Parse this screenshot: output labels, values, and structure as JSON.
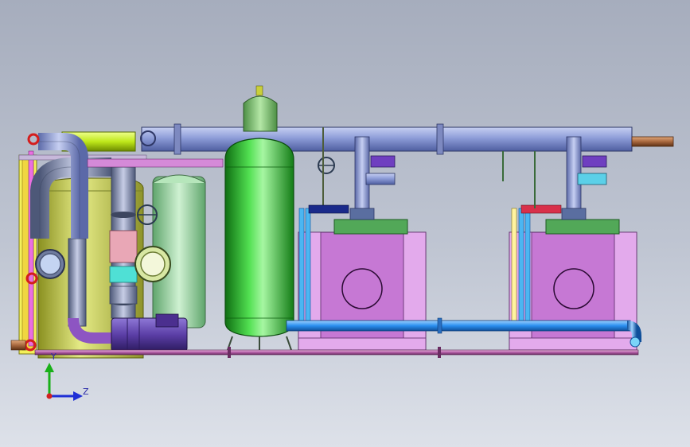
{
  "view": {
    "background_top": "#a6adbd",
    "background_bottom": "#dde1e9"
  },
  "triad": {
    "y_label": "Y",
    "z_label": "Z",
    "y_color": "#19b019",
    "z_color": "#1f2fd6",
    "origin_color": "#d42020"
  },
  "colors": {
    "main_header": "#8e9dd8",
    "main_tank": "#2bbd2b",
    "left_tank": "#c9cf66",
    "mid_tank": "#9fd9a7",
    "boxes": "#c678d4",
    "box_top": "#52a858",
    "water_pipe": "#2b8ff0",
    "drain_pipe": "#b35fa6",
    "yellow_green_pipe": "#bfe81a",
    "pump": "#5b3ea6"
  }
}
